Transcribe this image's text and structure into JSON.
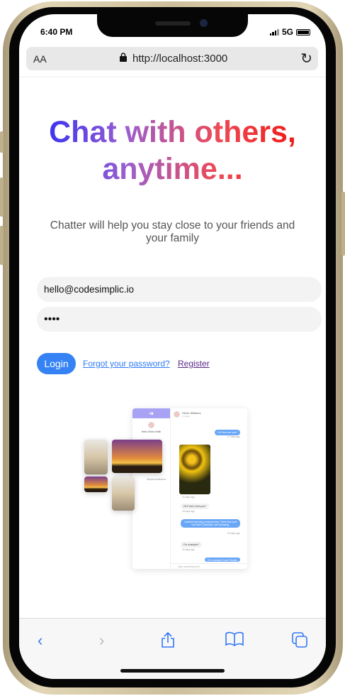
{
  "status": {
    "time": "6:40 PM",
    "network": "5G"
  },
  "browser": {
    "text_size": "AA",
    "url": "http://localhost:3000"
  },
  "hero": {
    "title_line1": "Chat with others,",
    "title_line2": "anytime...",
    "subtitle": "Chatter will help you stay close to your friends and your family"
  },
  "form": {
    "email": "hello@codesimplic.io",
    "password": "••••",
    "login": "Login",
    "forgot": "Forgot your password?",
    "register": "Register"
  },
  "illustration": {
    "greeting": "Hello Olivia Smith",
    "contact": "Oliver Williams",
    "contact_status": "1 image",
    "other_contact": "Sophia Anderson",
    "messages": [
      {
        "text": "Hi! How are you?",
        "time": "17 days ago"
      },
      {
        "text": "",
        "time": "19 days ago"
      },
      {
        "text": "Hi! Fresh. And you?",
        "time": "18 days ago"
      },
      {
        "text": "I started learning programming. There few cool YouTube Channels I am following.",
        "time": "16 days ago"
      },
      {
        "text": "For example?",
        "time": "19 days ago"
      },
      {
        "text": "For example Code Simplic",
        "time": ""
      }
    ],
    "input_placeholder": "Type something here"
  },
  "colors": {
    "accent": "#3582f5",
    "safari_blue": "#3478f6"
  }
}
